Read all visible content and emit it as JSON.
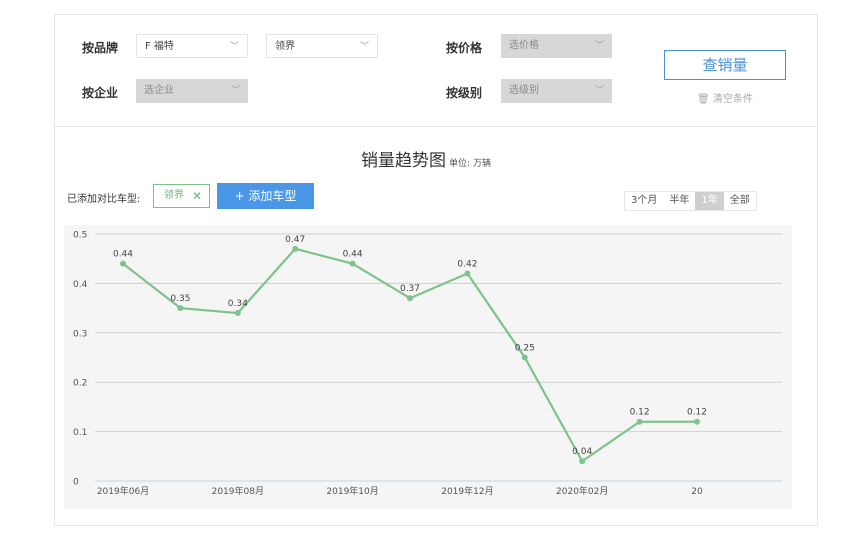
{
  "filters": {
    "brand_label": "按品牌",
    "brand_value": "F 福特",
    "model_value": "领界",
    "company_label": "按企业",
    "company_placeholder": "选企业",
    "price_label": "按价格",
    "price_placeholder": "选价格",
    "level_label": "按级别",
    "level_placeholder": "选级别",
    "query_button": "查销量",
    "clear_button": "清空条件"
  },
  "compare": {
    "label": "已添加对比车型:",
    "tag": "领界",
    "add_button": "+ 添加车型"
  },
  "ranges": {
    "options": [
      "3个月",
      "半年",
      "1年",
      "全部"
    ],
    "active": "1年"
  },
  "chart_data": {
    "type": "line",
    "title": "销量趋势图",
    "unit": "单位: 万辆",
    "x": [
      "2019-06",
      "2019-07",
      "2019-08",
      "2019-09",
      "2019-10",
      "2019-11",
      "2019-12",
      "2020-01",
      "2020-02",
      "2020-03",
      "2020-04"
    ],
    "values": [
      0.44,
      0.35,
      0.34,
      0.47,
      0.44,
      0.37,
      0.42,
      0.25,
      0.04,
      0.12,
      0.12
    ],
    "x_tick_labels": [
      "2019年06月",
      "2019年08月",
      "2019年10月",
      "2019年12月",
      "2020年02月",
      "20"
    ],
    "y_ticks": [
      0,
      0.1,
      0.2,
      0.3,
      0.4,
      0.5
    ],
    "ylim": [
      0,
      0.5
    ],
    "grid": true,
    "line_color": "#7dc38b"
  }
}
